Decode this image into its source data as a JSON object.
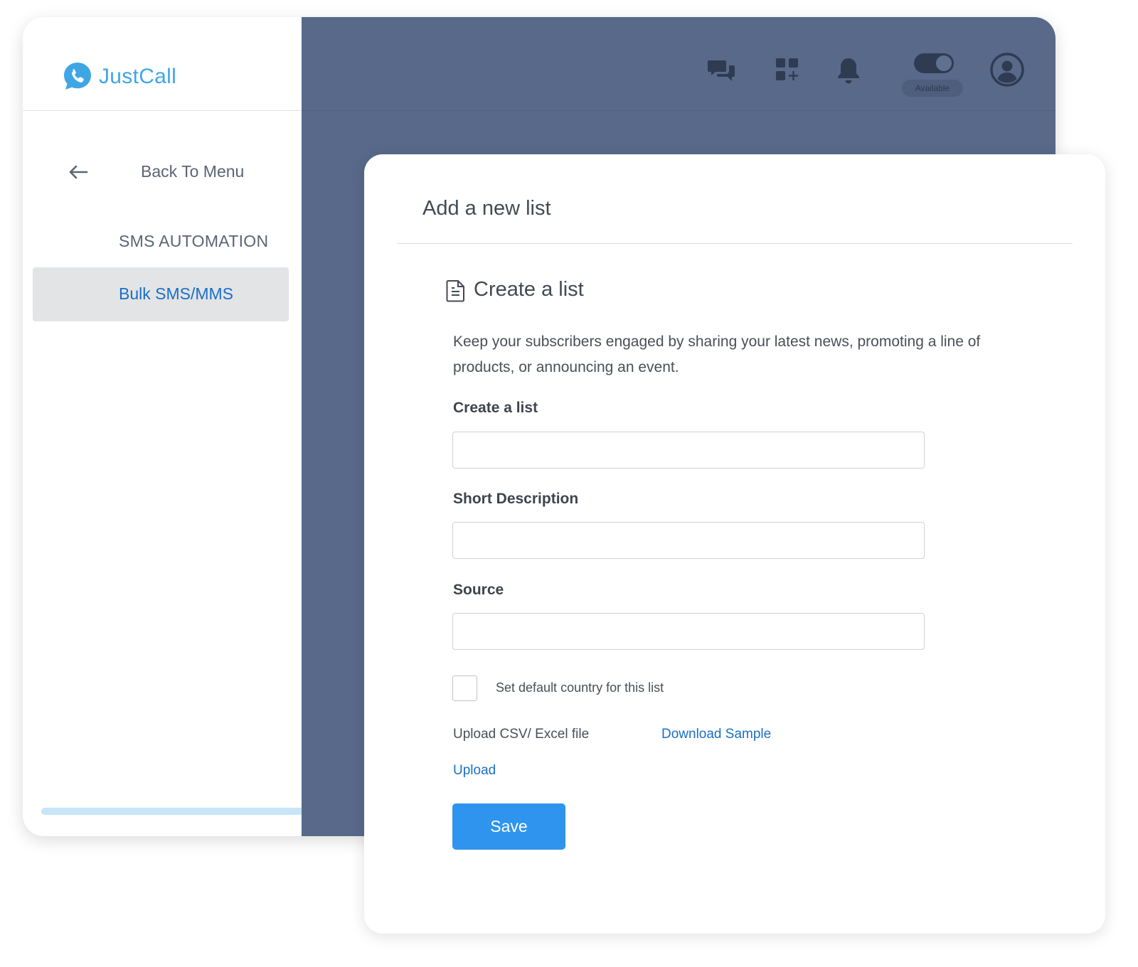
{
  "brand": {
    "name": "JustCall",
    "logo_icon": "justcall-logo-icon",
    "color": "#3fa6e6"
  },
  "sidebar": {
    "back_label": "Back To Menu",
    "section_label": "SMS AUTOMATION",
    "active_item": "Bulk SMS/MMS"
  },
  "topbar": {
    "icons": [
      "chat-bubbles-icon",
      "add-app-icon",
      "bell-icon",
      "user-avatar-icon"
    ],
    "availability": {
      "status": "Available",
      "on": true
    }
  },
  "modal": {
    "title": "Add a new list",
    "section_title": "Create a list",
    "intro": "Keep your subscribers engaged by sharing your latest news, promoting a line of products, or announcing an event.",
    "fields": {
      "list_name": {
        "label": "Create a list",
        "value": "",
        "placeholder": ""
      },
      "short_description": {
        "label": "Short Description",
        "value": "",
        "placeholder": ""
      },
      "source": {
        "label": "Source",
        "value": "",
        "placeholder": ""
      }
    },
    "default_country": {
      "label": "Set default country for this list",
      "checked": false
    },
    "upload": {
      "label": "Upload CSV/ Excel file",
      "download_sample": "Download Sample",
      "upload_link": "Upload"
    },
    "save_label": "Save"
  },
  "colors": {
    "main_background": "#58698a",
    "accent_blue": "#2f94ee",
    "link_blue": "#1a6fc7",
    "sidebar_active_bg": "#e3e4e6"
  }
}
